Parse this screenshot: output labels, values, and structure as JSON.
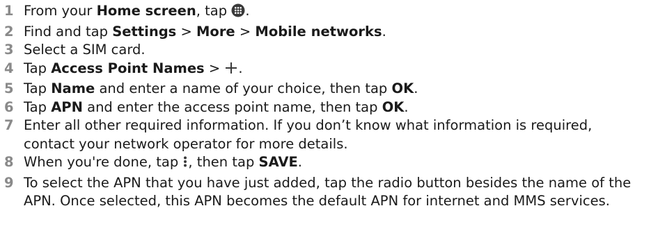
{
  "steps": [
    {
      "number": "1",
      "t1": "From your ",
      "b1": "Home screen",
      "t2": ", tap ",
      "icon": "apps-grid-icon",
      "t3": "."
    },
    {
      "number": "2",
      "t1": "Find and tap ",
      "b1": "Settings",
      "t2": " > ",
      "b2": "More",
      "t3": " > ",
      "b3": "Mobile networks",
      "t4": "."
    },
    {
      "number": "3",
      "t1": "Select a SIM card."
    },
    {
      "number": "4",
      "t1": "Tap ",
      "b1": "Access Point Names",
      "t2": " > ",
      "icon": "plus-icon",
      "t3": "."
    },
    {
      "number": "5",
      "t1": "Tap ",
      "b1": "Name",
      "t2": " and enter a name of your choice, then tap ",
      "b2": "OK",
      "t3": "."
    },
    {
      "number": "6",
      "t1": "Tap ",
      "b1": "APN",
      "t2": " and enter the access point name, then tap ",
      "b2": "OK",
      "t3": "."
    },
    {
      "number": "7",
      "t1": "Enter all other required information. If you don’t know what information is required, contact your network operator for more details."
    },
    {
      "number": "8",
      "t1": "When you're done, tap ",
      "icon": "more-vertical-icon",
      "t2": ", then tap ",
      "b1": "SAVE",
      "t3": "."
    },
    {
      "number": "9",
      "t1": "To select the APN that you have just added, tap the radio button besides the name of the APN. Once selected, this APN becomes the default APN for internet and MMS services."
    }
  ],
  "colors": {
    "step_number": "#8a8a8a",
    "text": "#1a1a1a",
    "icon": "#3a3a3a"
  }
}
